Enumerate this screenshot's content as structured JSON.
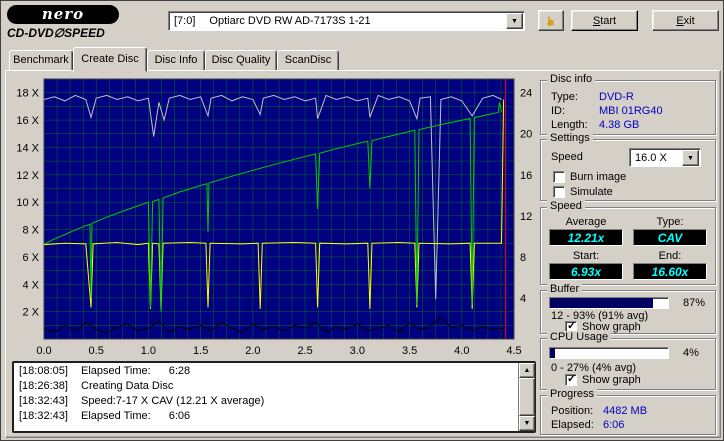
{
  "header": {
    "logo_main": "nero",
    "logo_sub": "CD-DVD∅SPEED",
    "drive_bus": "[7:0]",
    "drive_name": "Optiarc DVD RW AD-7173S 1-21",
    "hand_icon": "☛",
    "start_label": "Start",
    "exit_label": "Exit"
  },
  "tabs": [
    {
      "label": "Benchmark",
      "active": false
    },
    {
      "label": "Create Disc",
      "active": true
    },
    {
      "label": "Disc Info",
      "active": false
    },
    {
      "label": "Disc Quality",
      "active": false
    },
    {
      "label": "ScanDisc",
      "active": false
    }
  ],
  "chart_data": {
    "type": "line",
    "background": "#000080",
    "grid": {
      "color": "#00A000",
      "h_step": 1,
      "v_step": 0.125
    },
    "x_axis": {
      "min": 0,
      "max": 4.5,
      "ticks": [
        "0.0",
        "0.5",
        "1.0",
        "1.5",
        "2.0",
        "2.5",
        "3.0",
        "3.5",
        "4.0",
        "4.5"
      ]
    },
    "y_axis_left": {
      "min": 0,
      "max": 19,
      "ticks": [
        "2 X",
        "4 X",
        "6 X",
        "8 X",
        "10 X",
        "12 X",
        "14 X",
        "16 X",
        "18 X"
      ]
    },
    "y_axis_right": {
      "ticks": [
        "4",
        "8",
        "12",
        "16",
        "20",
        "24"
      ]
    },
    "series": [
      {
        "name": "buffer-level-gray",
        "color": "#c0c0c0",
        "width": 1,
        "points": [
          [
            0,
            17.5
          ],
          [
            0.1,
            17.7
          ],
          [
            0.2,
            17.4
          ],
          [
            0.3,
            17.8
          ],
          [
            0.4,
            17.5
          ],
          [
            0.45,
            16.2
          ],
          [
            0.5,
            17.6
          ],
          [
            0.6,
            17.8
          ],
          [
            0.7,
            17.5
          ],
          [
            0.8,
            17.7
          ],
          [
            0.9,
            17.4
          ],
          [
            1.0,
            17.6
          ],
          [
            1.05,
            14.8
          ],
          [
            1.1,
            17.3
          ],
          [
            1.15,
            16.0
          ],
          [
            1.2,
            17.6
          ],
          [
            1.3,
            17.8
          ],
          [
            1.4,
            17.5
          ],
          [
            1.5,
            17.7
          ],
          [
            1.57,
            16.3
          ],
          [
            1.6,
            17.6
          ],
          [
            1.7,
            17.8
          ],
          [
            1.8,
            17.4
          ],
          [
            1.9,
            17.7
          ],
          [
            2.0,
            17.5
          ],
          [
            2.07,
            16.4
          ],
          [
            2.1,
            17.6
          ],
          [
            2.2,
            17.8
          ],
          [
            2.3,
            17.5
          ],
          [
            2.4,
            17.7
          ],
          [
            2.5,
            17.4
          ],
          [
            2.6,
            17.6
          ],
          [
            2.62,
            16.1
          ],
          [
            2.7,
            17.8
          ],
          [
            2.8,
            17.5
          ],
          [
            2.9,
            17.7
          ],
          [
            3.0,
            17.4
          ],
          [
            3.1,
            17.6
          ],
          [
            3.12,
            16.2
          ],
          [
            3.2,
            17.8
          ],
          [
            3.3,
            17.5
          ],
          [
            3.4,
            17.7
          ],
          [
            3.5,
            17.4
          ],
          [
            3.57,
            16.1
          ],
          [
            3.6,
            17.6
          ],
          [
            3.7,
            17.7
          ],
          [
            3.75,
            2.9
          ],
          [
            3.8,
            17.5
          ],
          [
            3.9,
            17.7
          ],
          [
            4.0,
            17.4
          ],
          [
            4.1,
            16.3
          ],
          [
            4.2,
            17.6
          ],
          [
            4.3,
            17.8
          ],
          [
            4.38,
            17.5
          ]
        ]
      },
      {
        "name": "speed-yellow",
        "color": "#ffff00",
        "width": 1,
        "points": [
          [
            0,
            6.9
          ],
          [
            0.2,
            7.0
          ],
          [
            0.4,
            6.95
          ],
          [
            0.45,
            2.3
          ],
          [
            0.47,
            6.95
          ],
          [
            0.7,
            7.05
          ],
          [
            0.9,
            6.9
          ],
          [
            1.0,
            7.0
          ],
          [
            1.02,
            2.2
          ],
          [
            1.04,
            7.0
          ],
          [
            1.1,
            6.95
          ],
          [
            1.12,
            2.1
          ],
          [
            1.14,
            7.0
          ],
          [
            1.4,
            7.05
          ],
          [
            1.55,
            7.0
          ],
          [
            1.57,
            2.3
          ],
          [
            1.59,
            7.0
          ],
          [
            1.9,
            6.95
          ],
          [
            2.05,
            7.0
          ],
          [
            2.07,
            2.2
          ],
          [
            2.09,
            7.0
          ],
          [
            2.4,
            7.05
          ],
          [
            2.6,
            7.0
          ],
          [
            2.62,
            2.3
          ],
          [
            2.64,
            7.0
          ],
          [
            2.9,
            6.95
          ],
          [
            3.1,
            7.0
          ],
          [
            3.12,
            2.2
          ],
          [
            3.14,
            7.0
          ],
          [
            3.4,
            7.05
          ],
          [
            3.55,
            7.0
          ],
          [
            3.57,
            2.3
          ],
          [
            3.59,
            7.0
          ],
          [
            3.9,
            6.95
          ],
          [
            4.08,
            7.0
          ],
          [
            4.1,
            2.2
          ],
          [
            4.12,
            7.0
          ],
          [
            4.3,
            7.0
          ],
          [
            4.38,
            7.0
          ],
          [
            4.4,
            17.5
          ]
        ]
      },
      {
        "name": "write-speed-green",
        "color": "#00cc00",
        "width": 1,
        "points": [
          [
            0,
            6.93
          ],
          [
            0.1,
            7.3
          ],
          [
            0.2,
            7.64
          ],
          [
            0.3,
            7.97
          ],
          [
            0.4,
            8.28
          ],
          [
            0.44,
            8.4
          ],
          [
            0.45,
            3.0
          ],
          [
            0.46,
            8.45
          ],
          [
            0.6,
            8.9
          ],
          [
            0.8,
            9.46
          ],
          [
            1.0,
            10.0
          ],
          [
            1.02,
            2.3
          ],
          [
            1.04,
            10.05
          ],
          [
            1.1,
            10.2
          ],
          [
            1.12,
            2.0
          ],
          [
            1.14,
            10.3
          ],
          [
            1.3,
            10.75
          ],
          [
            1.5,
            11.22
          ],
          [
            1.56,
            11.35
          ],
          [
            1.57,
            7.8
          ],
          [
            1.58,
            11.4
          ],
          [
            1.8,
            11.9
          ],
          [
            2.0,
            12.33
          ],
          [
            2.2,
            12.74
          ],
          [
            2.4,
            13.14
          ],
          [
            2.6,
            13.53
          ],
          [
            2.62,
            9.5
          ],
          [
            2.64,
            13.57
          ],
          [
            2.8,
            13.91
          ],
          [
            3.0,
            14.28
          ],
          [
            3.1,
            14.46
          ],
          [
            3.12,
            11.0
          ],
          [
            3.14,
            14.5
          ],
          [
            3.4,
            14.99
          ],
          [
            3.55,
            15.25
          ],
          [
            3.57,
            2.5
          ],
          [
            3.59,
            15.3
          ],
          [
            3.8,
            15.67
          ],
          [
            4.0,
            15.99
          ],
          [
            4.08,
            16.12
          ],
          [
            4.1,
            2.5
          ],
          [
            4.12,
            16.17
          ],
          [
            4.25,
            16.4
          ],
          [
            4.3,
            16.48
          ],
          [
            4.35,
            16.55
          ],
          [
            4.36,
            17.3
          ],
          [
            4.38,
            16.6
          ]
        ]
      },
      {
        "name": "cpu-usage-black",
        "color": "#000000",
        "width": 1,
        "points": [
          [
            0,
            0.8
          ],
          [
            0.1,
            0.5
          ],
          [
            0.2,
            1.0
          ],
          [
            0.3,
            0.6
          ],
          [
            0.4,
            1.2
          ],
          [
            0.5,
            0.7
          ],
          [
            0.6,
            0.4
          ],
          [
            0.7,
            0.9
          ],
          [
            0.8,
            1.1
          ],
          [
            0.9,
            0.6
          ],
          [
            1.0,
            0.8
          ],
          [
            1.1,
            1.3
          ],
          [
            1.2,
            0.5
          ],
          [
            1.3,
            0.9
          ],
          [
            1.4,
            0.7
          ],
          [
            1.5,
            1.0
          ],
          [
            1.6,
            0.6
          ],
          [
            1.7,
            1.2
          ],
          [
            1.8,
            0.8
          ],
          [
            1.9,
            0.5
          ],
          [
            2.0,
            1.1
          ],
          [
            2.1,
            0.7
          ],
          [
            2.2,
            0.9
          ],
          [
            2.3,
            0.6
          ],
          [
            2.4,
            1.0
          ],
          [
            2.5,
            0.8
          ],
          [
            2.6,
            1.2
          ],
          [
            2.7,
            0.5
          ],
          [
            2.8,
            0.9
          ],
          [
            2.9,
            0.7
          ],
          [
            3.0,
            1.1
          ],
          [
            3.1,
            0.6
          ],
          [
            3.2,
            0.8
          ],
          [
            3.3,
            1.0
          ],
          [
            3.4,
            0.5
          ],
          [
            3.5,
            1.2
          ],
          [
            3.6,
            0.7
          ],
          [
            3.7,
            0.9
          ],
          [
            3.8,
            1.6
          ],
          [
            3.9,
            0.8
          ],
          [
            4.0,
            1.0
          ],
          [
            4.1,
            0.6
          ],
          [
            4.2,
            0.9
          ],
          [
            4.3,
            0.7
          ],
          [
            4.4,
            0.8
          ]
        ]
      }
    ],
    "markers": [
      {
        "name": "position-marker",
        "x": 4.42,
        "color": "#ff0000"
      }
    ],
    "summary": {
      "write_start_x": 6.93,
      "write_end_x": 16.6,
      "write_avg_x": 12.21,
      "type": "CAV",
      "capacity_gb": 4.38
    }
  },
  "disc_info": {
    "title": "Disc info",
    "type_label": "Type:",
    "type_value": "DVD-R",
    "id_label": "ID:",
    "id_value": "MBI 01RG40",
    "length_label": "Length:",
    "length_value": "4.38 GB"
  },
  "settings": {
    "title": "Settings",
    "speed_label": "Speed",
    "speed_value": "16.0 X",
    "burn_image_label": "Burn image",
    "burn_image_checked": false,
    "simulate_label": "Simulate",
    "simulate_checked": false
  },
  "speed": {
    "title": "Speed",
    "average_label": "Average",
    "type_label": "Type:",
    "average_value": "12.21x",
    "type_value": "CAV",
    "start_label": "Start:",
    "end_label": "End:",
    "start_value": "6.93x",
    "end_value": "16.60x",
    "value_color": "#00ffff"
  },
  "buffer": {
    "title": "Buffer",
    "percent_label": "87%",
    "fill_percent": 87,
    "range_text": "12 - 93% (91% avg)",
    "show_graph_label": "Show graph",
    "show_graph_checked": true
  },
  "cpu": {
    "title": "CPU Usage",
    "percent_label": "4%",
    "fill_percent": 4,
    "range_text": "0 - 27% (4% avg)",
    "show_graph_label": "Show graph",
    "show_graph_checked": true
  },
  "progress": {
    "title": "Progress",
    "position_label": "Position:",
    "position_value": "4482 MB",
    "elapsed_label": "Elapsed:",
    "elapsed_value": "6:06"
  },
  "log": {
    "rows": [
      {
        "time": "[18:08:05]",
        "text": "Elapsed Time:",
        "value": "6:28"
      },
      {
        "time": "[18:26:38]",
        "text": "Creating Data Disc",
        "value": ""
      },
      {
        "time": "[18:32:43]",
        "text": "Speed:7-17 X CAV (12.21 X average)",
        "value": ""
      },
      {
        "time": "[18:32:43]",
        "text": "Elapsed Time:",
        "value": "6:06"
      }
    ]
  }
}
